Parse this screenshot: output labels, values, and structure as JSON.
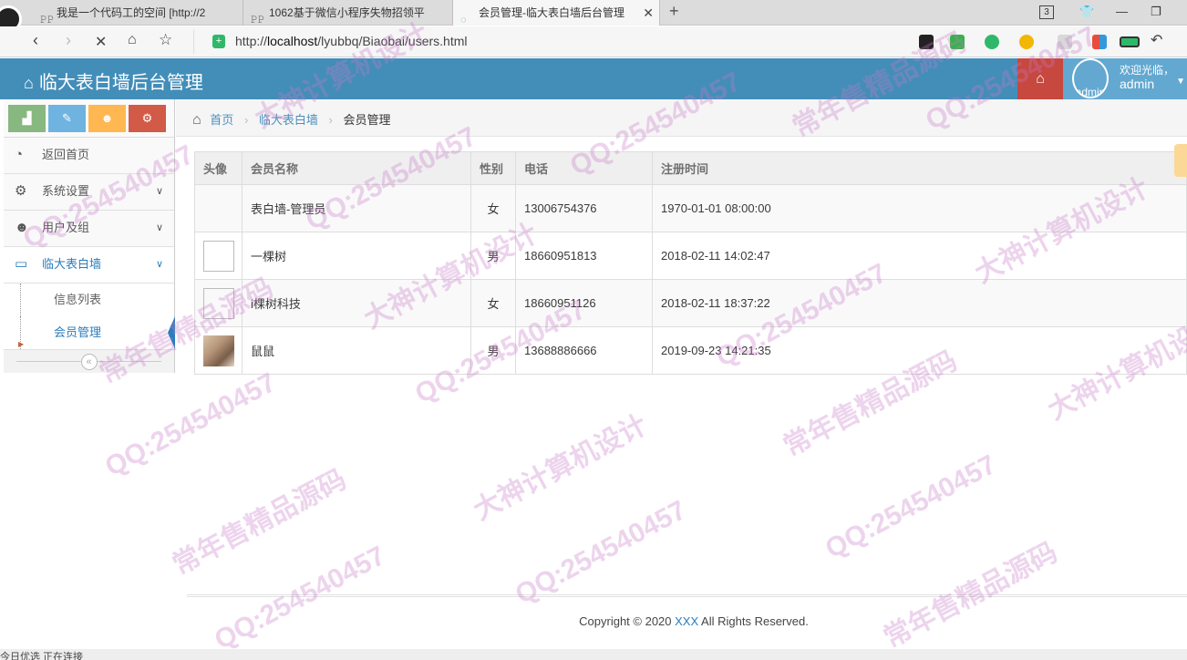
{
  "browser": {
    "tabs": [
      {
        "title": "我是一个代码工的空间 [http://2"
      },
      {
        "title": "1062基于微信小程序失物招领平"
      },
      {
        "title": "会员管理-临大表白墙后台管理"
      }
    ],
    "tab_count": "3",
    "url_prefix": "http://",
    "url_host": "localhost",
    "url_path": "/lyubbq/Biaobai/users.html"
  },
  "header": {
    "brand": "临大表白墙后台管理",
    "welcome": "欢迎光临，",
    "username": "admin",
    "avatar_alt": "admin"
  },
  "sidebar": {
    "items": [
      {
        "label": "返回首页",
        "icon": "dashboard-icon"
      },
      {
        "label": "系统设置",
        "icon": "cog-icon"
      },
      {
        "label": "用户及组",
        "icon": "users-icon"
      },
      {
        "label": "临大表白墙",
        "icon": "desktop-icon"
      }
    ],
    "submenu": [
      {
        "label": "信息列表"
      },
      {
        "label": "会员管理"
      }
    ],
    "collapse_glyph": "«"
  },
  "breadcrumb": {
    "home": "首页",
    "section": "临大表白墙",
    "current": "会员管理"
  },
  "table": {
    "headers": [
      "头像",
      "会员名称",
      "性别",
      "电话",
      "注册时间"
    ],
    "rows": [
      {
        "name": "表白墙-管理员",
        "gender": "女",
        "phone": "13006754376",
        "registered": "1970-01-01 08:00:00"
      },
      {
        "name": "一棵树",
        "gender": "男",
        "phone": "18660951813",
        "registered": "2018-02-11 14:02:47"
      },
      {
        "name": "i棵树科技",
        "gender": "女",
        "phone": "18660951126",
        "registered": "2018-02-11 18:37:22"
      },
      {
        "name": "鼠鼠",
        "gender": "男",
        "phone": "13688886666",
        "registered": "2019-09-23 14:21:35"
      }
    ]
  },
  "footer": {
    "prefix": "Copyright © 2020 ",
    "link": "XXX",
    "suffix": " All Rights Reserved."
  },
  "statusbar": {
    "left": "今日优选   正在连接"
  },
  "watermarks": {
    "qq": "QQ:254540457",
    "a": "大神计算机设计",
    "b": "常年售精品源码"
  },
  "colors": {
    "header": "#438eb9",
    "accent": "#2b7dbc",
    "home_btn": "#c6483e"
  }
}
